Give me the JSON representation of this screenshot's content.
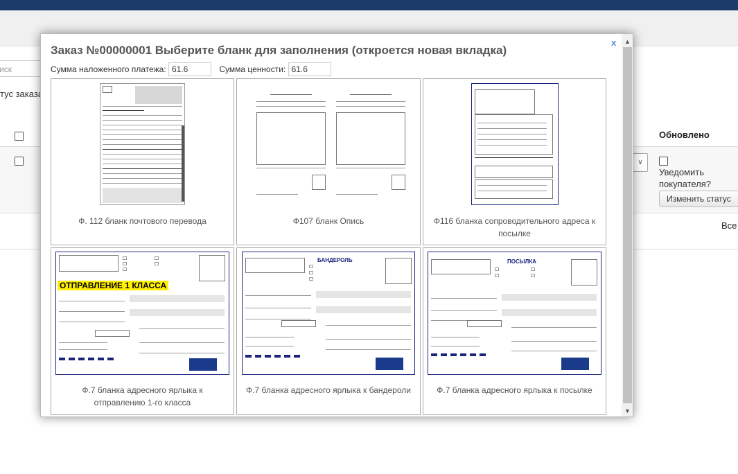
{
  "background": {
    "search_placeholder": "иск",
    "status_label": "тус заказа",
    "updated_header": "Обновлено",
    "notify_label": "Уведомить покупателя?",
    "change_status_button": "Изменить статус",
    "all_label": "Все"
  },
  "modal": {
    "title": "Заказ №00000001 Выберите бланк для заполнения (откроется новая вкладка)",
    "close_label": "x",
    "cod_label": "Сумма наложенного платежа:",
    "cod_value": "61.6",
    "value_label": "Сумма ценности:",
    "value_value": "61.6",
    "forms": [
      {
        "caption": "Ф. 112 бланк почтового перевода",
        "kind": "f112"
      },
      {
        "caption": "Ф107 бланк Опись",
        "kind": "f107"
      },
      {
        "caption": "Ф116 бланка сопроводительного адреса к посылке",
        "kind": "f116"
      },
      {
        "caption": "Ф.7 бланка адресного ярлыка к отправлению 1-го класса",
        "kind": "f7a",
        "banner": "ОТПРАВЛЕНИЕ 1 КЛАССА"
      },
      {
        "caption": "Ф.7 бланка адресного ярлыка к бандероли",
        "kind": "f7b",
        "banner": "БАНДЕРОЛЬ"
      },
      {
        "caption": "Ф.7 бланка адресного ярлыка к посылке",
        "kind": "f7c",
        "banner": "ПОСЫЛКА"
      }
    ]
  }
}
